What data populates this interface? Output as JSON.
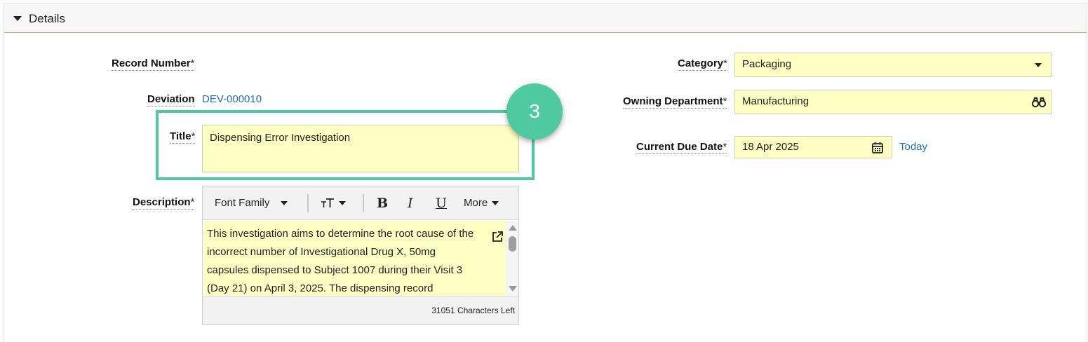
{
  "section": {
    "title": "Details"
  },
  "form": {
    "record_number": {
      "label": "Record Number",
      "required": "*"
    },
    "deviation": {
      "label": "Deviation",
      "value": "DEV-000010"
    },
    "title": {
      "label": "Title",
      "required": "*",
      "value": "Dispensing Error Investigation"
    },
    "description": {
      "label": "Description",
      "required": "*",
      "toolbar": {
        "font_family": "Font Family",
        "bold": "B",
        "italic": "I",
        "underline": "U",
        "more": "More"
      },
      "value": "This investigation aims to determine the root cause of the incorrect number of Investigational Drug X, 50mg capsules dispensed to Subject 1007 during their Visit 3 (Day 21) on April 3, 2025. The dispensing record indicated",
      "chars_left": "31051 Characters Left"
    },
    "category": {
      "label": "Category",
      "required": "*",
      "value": "Packaging"
    },
    "owning_department": {
      "label": "Owning Department",
      "required": "*",
      "value": "Manufacturing"
    },
    "current_due_date": {
      "label": "Current Due Date",
      "required": "*",
      "value": "18 Apr 2025",
      "today_link": "Today"
    }
  },
  "annotation": {
    "step": "3"
  },
  "colors": {
    "field_bg": "#ffffc4",
    "highlight": "#4fc9a0",
    "link": "#1f6fb5",
    "header_accent": "#e8a057"
  },
  "icons": {
    "collapse": "caret-down-icon",
    "lookup": "binoculars-icon",
    "calendar": "calendar-icon",
    "popout": "external-link-icon"
  }
}
